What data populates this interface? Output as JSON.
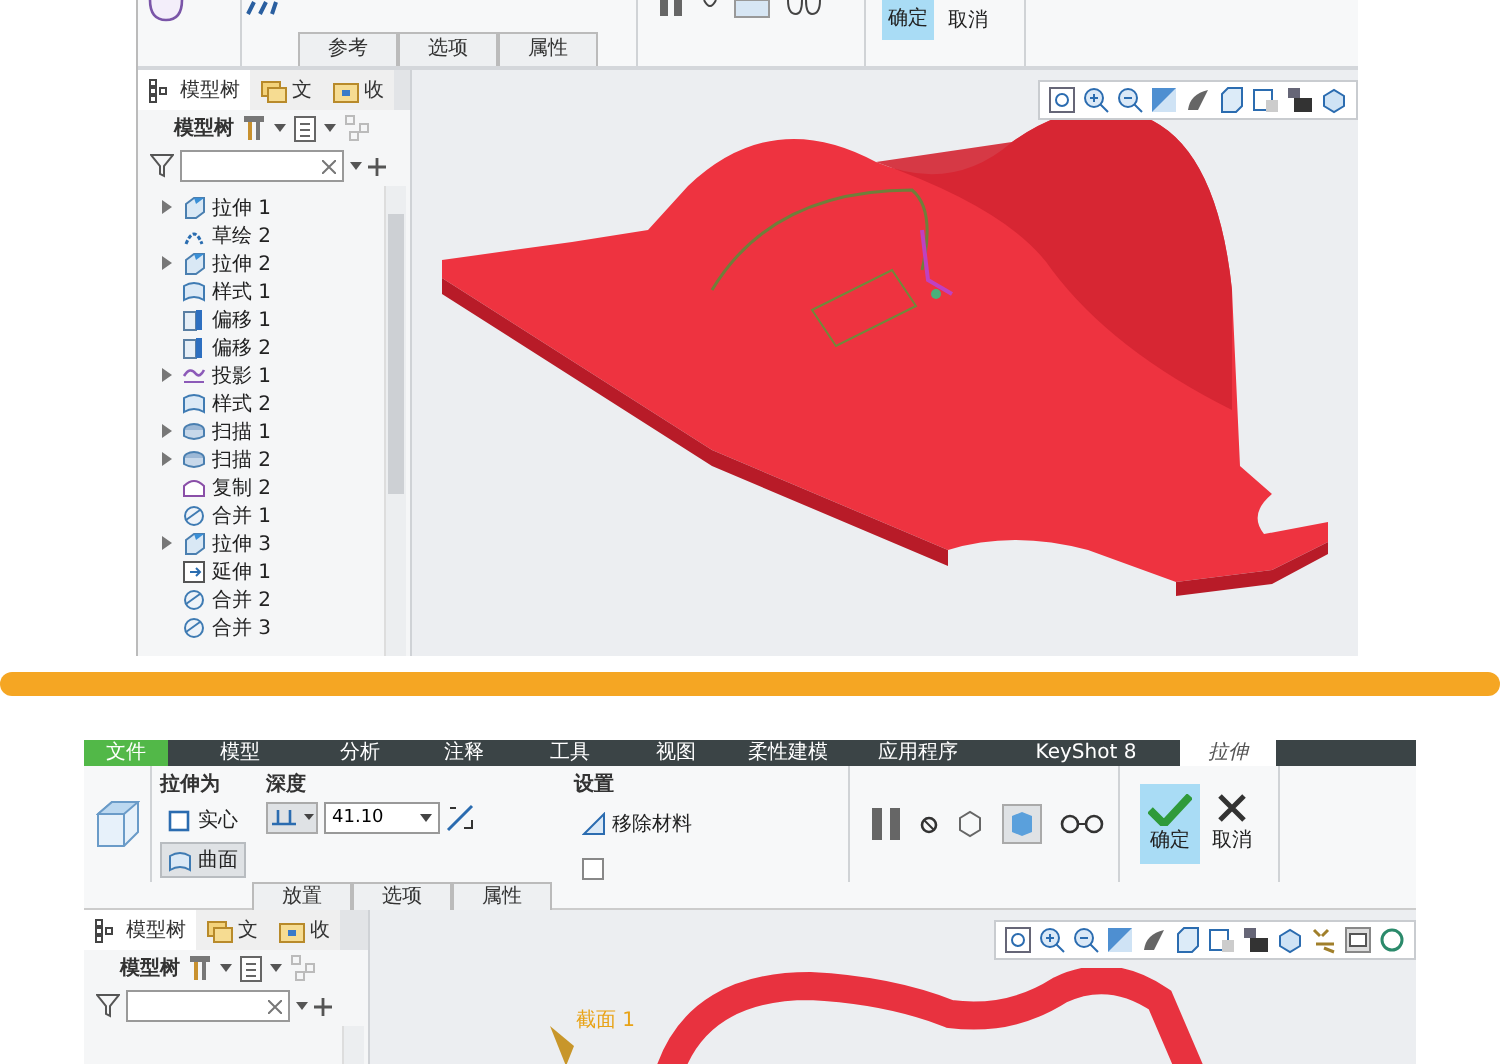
{
  "top_screenshot": {
    "ribbon_tabs": [
      {
        "label": "参考",
        "selected": false
      },
      {
        "label": "选项",
        "selected": false
      },
      {
        "label": "属性",
        "selected": false
      }
    ],
    "confirm": "确定",
    "cancel": "取消",
    "panel_tabs": [
      {
        "label": "模型树",
        "selected": true
      },
      {
        "label": "文",
        "selected": false
      },
      {
        "label": "收",
        "selected": false
      }
    ],
    "tree_title": "模型树",
    "tree_items": [
      {
        "label": "拉伸 1",
        "kind": "extrude",
        "expandable": true
      },
      {
        "label": "草绘 2",
        "kind": "sketch",
        "expandable": false
      },
      {
        "label": "拉伸 2",
        "kind": "extrude",
        "expandable": true
      },
      {
        "label": "样式 1",
        "kind": "style",
        "expandable": false
      },
      {
        "label": "偏移 1",
        "kind": "offset",
        "expandable": false
      },
      {
        "label": "偏移 2",
        "kind": "offset",
        "expandable": false
      },
      {
        "label": "投影 1",
        "kind": "project",
        "expandable": true
      },
      {
        "label": "样式 2",
        "kind": "style",
        "expandable": false
      },
      {
        "label": "扫描 1",
        "kind": "sweep",
        "expandable": true
      },
      {
        "label": "扫描 2",
        "kind": "sweep",
        "expandable": true
      },
      {
        "label": "复制 2",
        "kind": "copy",
        "expandable": false
      },
      {
        "label": "合并 1",
        "kind": "merge",
        "expandable": false
      },
      {
        "label": "拉伸 3",
        "kind": "extrude",
        "expandable": true
      },
      {
        "label": "延伸 1",
        "kind": "extend",
        "expandable": false
      },
      {
        "label": "合并 2",
        "kind": "merge",
        "expandable": false
      },
      {
        "label": "合并 3",
        "kind": "merge",
        "expandable": false
      }
    ]
  },
  "bottom_screenshot": {
    "menu": [
      {
        "label": "文件",
        "kind": "file",
        "selected": false
      },
      {
        "label": "模型",
        "kind": "tab",
        "selected": false
      },
      {
        "label": "分析",
        "kind": "tab",
        "selected": false
      },
      {
        "label": "注释",
        "kind": "tab",
        "selected": false
      },
      {
        "label": "工具",
        "kind": "tab",
        "selected": false
      },
      {
        "label": "视图",
        "kind": "tab",
        "selected": false
      },
      {
        "label": "柔性建模",
        "kind": "tab",
        "selected": false
      },
      {
        "label": "应用程序",
        "kind": "tab",
        "selected": false
      },
      {
        "label": "KeyShot 8",
        "kind": "tab",
        "selected": false
      },
      {
        "label": "拉伸",
        "kind": "tab",
        "selected": true
      }
    ],
    "extrude_as": {
      "title": "拉伸为",
      "options": [
        {
          "label": "实心",
          "selected": false
        },
        {
          "label": "曲面",
          "selected": true
        }
      ]
    },
    "depth": {
      "title": "深度",
      "value": "41.10"
    },
    "settings": {
      "title": "设置",
      "remove_material": "移除材料",
      "extra_checked": false
    },
    "confirm": "确定",
    "cancel": "取消",
    "ribbon_tabs": [
      {
        "label": "放置",
        "selected": false
      },
      {
        "label": "选项",
        "selected": false
      },
      {
        "label": "属性",
        "selected": false
      }
    ],
    "panel_tabs": [
      {
        "label": "模型树",
        "selected": true
      },
      {
        "label": "文",
        "selected": false
      },
      {
        "label": "收",
        "selected": false
      }
    ],
    "tree_title": "模型树",
    "section_label": "截面 1"
  }
}
